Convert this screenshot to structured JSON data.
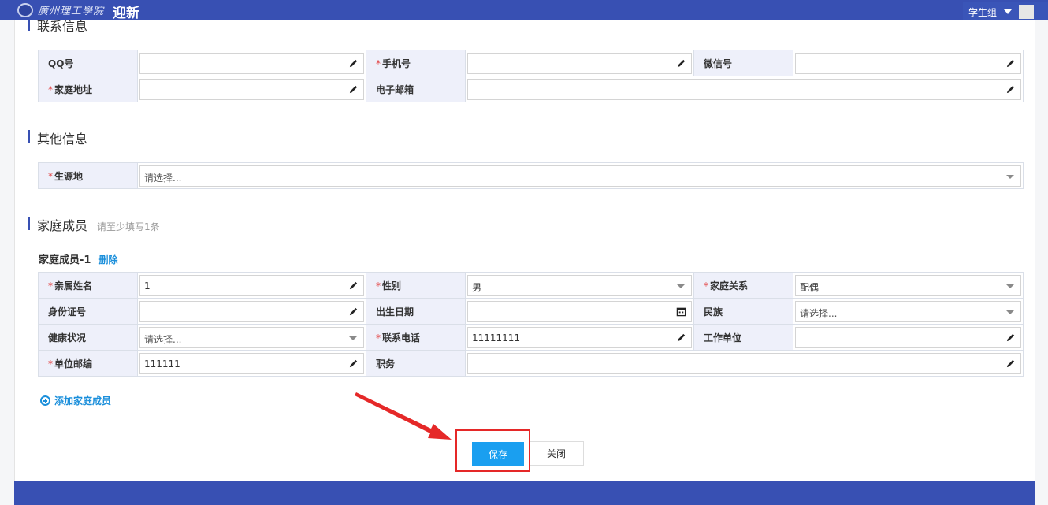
{
  "header": {
    "school_name": "廣州理工學院",
    "app_title": "迎新",
    "user_role": "学生组"
  },
  "contact": {
    "title": "联系信息",
    "qq_label": "QQ号",
    "phone_label": "手机号",
    "wechat_label": "微信号",
    "address_label": "家庭地址",
    "email_label": "电子邮箱"
  },
  "other": {
    "title": "其他信息",
    "origin_label": "生源地",
    "origin_placeholder": "请选择..."
  },
  "family": {
    "title": "家庭成员",
    "hint": "请至少填写1条",
    "member_title": "家庭成员-1",
    "delete_label": "删除",
    "name_label": "亲属姓名",
    "name_value": "1",
    "gender_label": "性别",
    "gender_value": "男",
    "relation_label": "家庭关系",
    "relation_value": "配偶",
    "id_label": "身份证号",
    "birth_label": "出生日期",
    "ethnic_label": "民族",
    "ethnic_placeholder": "请选择...",
    "health_label": "健康状况",
    "health_placeholder": "请选择...",
    "contact_phone_label": "联系电话",
    "contact_phone_value": "11111111",
    "workplace_label": "工作单位",
    "postcode_label": "单位邮编",
    "postcode_value": "111111",
    "position_label": "职务",
    "add_member_label": "添加家庭成员"
  },
  "actions": {
    "save_label": "保存",
    "close_label": "关闭"
  },
  "icons": {
    "edit": "pencil-icon",
    "calendar": "calendar-icon",
    "dropdown": "caret-down-icon",
    "add": "plus-circle-icon"
  },
  "colors": {
    "primary": "#3850b3",
    "accent": "#1a9ff0",
    "required": "#e23c3c",
    "annotation": "#e52828"
  }
}
